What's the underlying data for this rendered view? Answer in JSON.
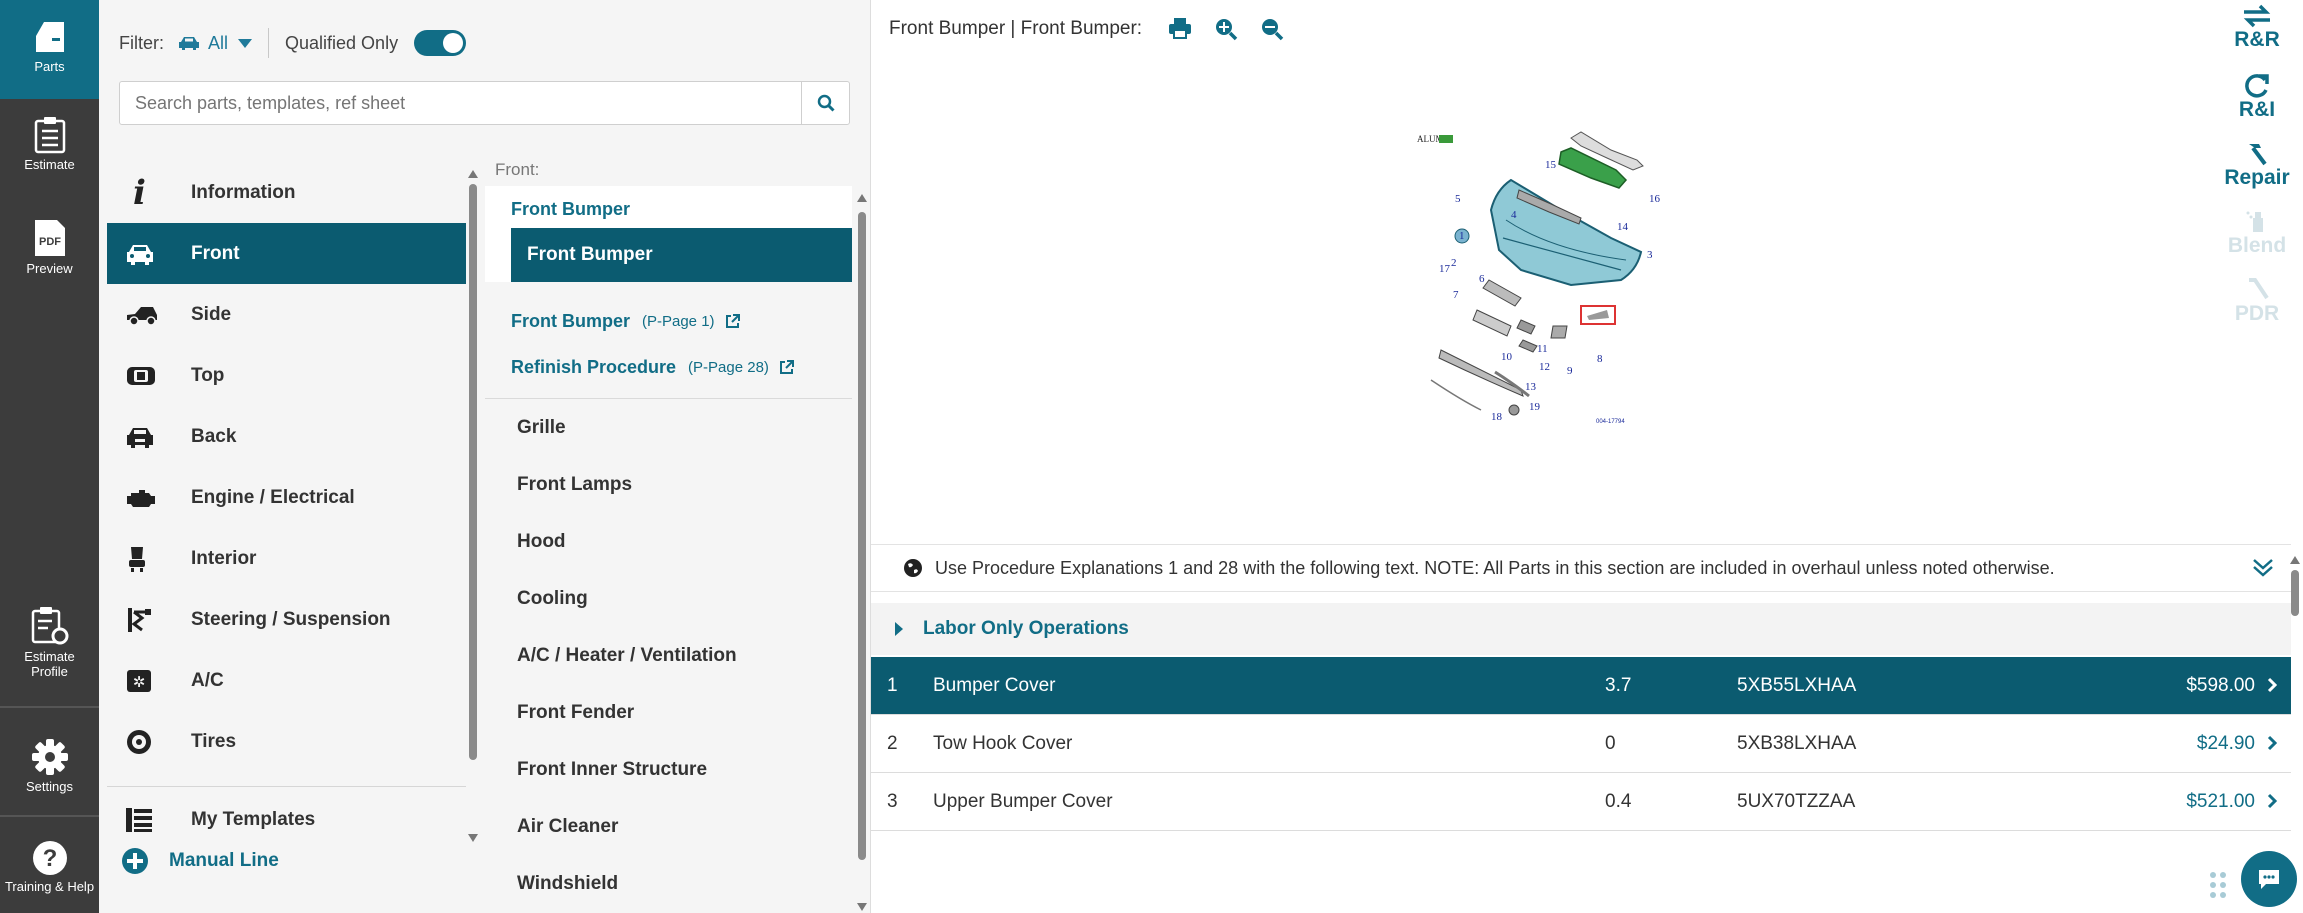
{
  "rail": {
    "parts": "Parts",
    "estimate": "Estimate",
    "pdf_badge": "PDF",
    "preview": "Preview",
    "estimate_profile": "Estimate Profile",
    "settings": "Settings",
    "training": "Training & Help"
  },
  "filter": {
    "label": "Filter:",
    "value": "All",
    "qualified_label": "Qualified Only",
    "qualified_on": true
  },
  "search": {
    "placeholder": "Search parts, templates, ref sheet"
  },
  "categories": [
    {
      "label": "Information",
      "icon": "info-icon"
    },
    {
      "label": "Front",
      "icon": "car-front-icon",
      "active": true
    },
    {
      "label": "Side",
      "icon": "car-side-icon"
    },
    {
      "label": "Top",
      "icon": "car-top-icon"
    },
    {
      "label": "Back",
      "icon": "car-back-icon"
    },
    {
      "label": "Engine / Electrical",
      "icon": "engine-icon"
    },
    {
      "label": "Interior",
      "icon": "seat-icon"
    },
    {
      "label": "Steering / Suspension",
      "icon": "suspension-icon"
    },
    {
      "label": "A/C",
      "icon": "ac-icon"
    },
    {
      "label": "Tires",
      "icon": "tire-icon"
    }
  ],
  "extra": {
    "my_templates": "My Templates",
    "manual_line": "Manual Line"
  },
  "sub": {
    "header": "Front:",
    "group": "Front Bumper",
    "selected": "Front Bumper",
    "links": [
      {
        "label": "Front Bumper",
        "page": "(P-Page 1)"
      },
      {
        "label": "Refinish Procedure",
        "page": "(P-Page 28)"
      }
    ],
    "items": [
      "Grille",
      "Front Lamps",
      "Hood",
      "Cooling",
      "A/C / Heater / Ventilation",
      "Front Fender",
      "Front Inner Structure",
      "Air Cleaner",
      "Windshield"
    ]
  },
  "main": {
    "breadcrumb": "Front Bumper | Front Bumper:",
    "note": "Use Procedure Explanations 1 and 28 with the following text. NOTE: All Parts in this section are included in overhaul unless noted otherwise.",
    "labor_only": "Labor Only Operations",
    "diagram": {
      "corner_label": "ALUM",
      "ref": "004-17794",
      "callouts": [
        "1",
        "2",
        "3",
        "4",
        "5",
        "6",
        "7",
        "8",
        "9",
        "10",
        "11",
        "12",
        "13",
        "14",
        "15",
        "16",
        "17",
        "18",
        "19"
      ]
    },
    "rows": [
      {
        "num": "1",
        "desc": "Bumper Cover",
        "hours": "3.7",
        "part": "5XB55LXHAA",
        "price": "$598.00",
        "active": true
      },
      {
        "num": "2",
        "desc": "Tow Hook Cover",
        "hours": "0",
        "part": "5XB38LXHAA",
        "price": "$24.90"
      },
      {
        "num": "3",
        "desc": "Upper Bumper Cover",
        "hours": "0.4",
        "part": "5UX70TZZAA",
        "price": "$521.00"
      }
    ]
  },
  "operations": [
    {
      "label": "R&R",
      "enabled": true,
      "icon": "arrows-icon"
    },
    {
      "label": "R&I",
      "enabled": true,
      "icon": "refresh-icon"
    },
    {
      "label": "Repair",
      "enabled": true,
      "icon": "hammer-icon"
    },
    {
      "label": "Blend",
      "enabled": false,
      "icon": "spray-icon"
    },
    {
      "label": "PDR",
      "enabled": false,
      "icon": "pdr-tool-icon"
    }
  ],
  "colors": {
    "accent": "#116d86",
    "dark_accent": "#0b5b70",
    "rail": "#3c3c3c"
  }
}
